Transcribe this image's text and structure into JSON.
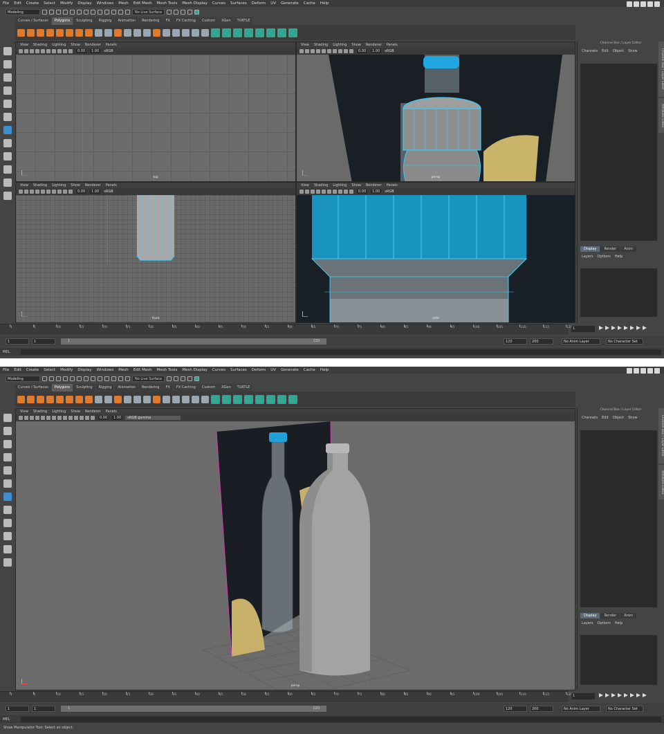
{
  "menu": [
    "File",
    "Edit",
    "Create",
    "Select",
    "Modify",
    "Display",
    "Windows",
    "Mesh",
    "Edit Mesh",
    "Mesh Tools",
    "Mesh Display",
    "Curves",
    "Surfaces",
    "Deform",
    "UV",
    "Generate",
    "Cache",
    "Help"
  ],
  "mode_selector": "Modeling",
  "live_surface": "No Live Surface",
  "shelf_tabs": [
    "Curves / Surfaces",
    "Polygons",
    "Sculpting",
    "Rigging",
    "Animation",
    "Rendering",
    "FX",
    "FX Caching",
    "Custom",
    "XGen",
    "TURTLE"
  ],
  "shelf_active": "Polygons",
  "panel_menu": [
    "View",
    "Shading",
    "Lighting",
    "Show",
    "Renderer",
    "Panels"
  ],
  "vp_fields": {
    "exposure": "0.00",
    "gamma": "1.00",
    "colorspace": "sRGB",
    "colorspace_full": "sRGB gamma"
  },
  "viewports_top": [
    {
      "label": "top"
    },
    {
      "label": "persp"
    },
    {
      "label": "front"
    },
    {
      "label": "side"
    }
  ],
  "viewport_bottom": {
    "label": "persp"
  },
  "channel_box": {
    "title": "Channel Box / Layer Editor",
    "menu": [
      "Channels",
      "Edit",
      "Object",
      "Show"
    ]
  },
  "layer_editor": {
    "tabs": [
      "Display",
      "Render",
      "Anim"
    ],
    "active": "Display",
    "menu": [
      "Layers",
      "Options",
      "Help"
    ]
  },
  "side_tabs": [
    "Channel Box / Layer Editor",
    "Attribute Editor"
  ],
  "timeline_ticks": [
    "1",
    "5",
    "10",
    "15",
    "20",
    "25",
    "30",
    "35",
    "40",
    "45",
    "50",
    "55",
    "60",
    "65",
    "70",
    "75",
    "80",
    "85",
    "90",
    "95",
    "100",
    "105",
    "110",
    "115",
    "120"
  ],
  "current_frame": "1",
  "range": {
    "start": "1",
    "inner_start": "1",
    "slider_start": "1",
    "slider_end": "120",
    "end": "120",
    "max": "200"
  },
  "anim_layer": "No Anim Layer",
  "char_set": "No Character Set",
  "mel_label": "MEL",
  "help_line": "Show Manipulator Tool: Select an object."
}
